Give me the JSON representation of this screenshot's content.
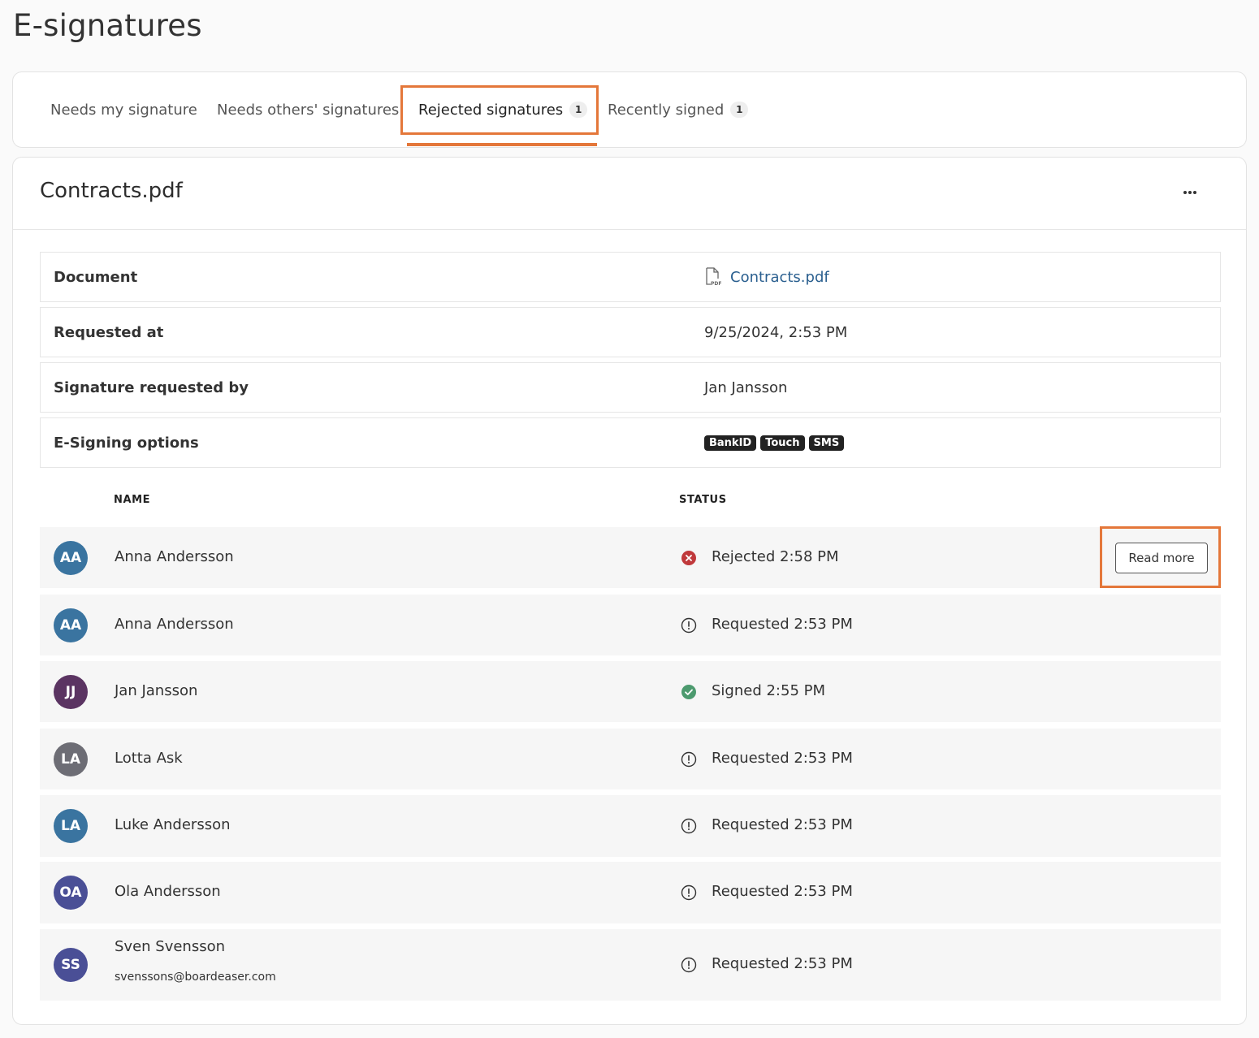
{
  "page": {
    "title": "E-signatures"
  },
  "tabs": [
    {
      "label": "Needs my signature",
      "count": ""
    },
    {
      "label": "Needs others' signatures",
      "count": ""
    },
    {
      "label": "Rejected signatures",
      "count": "1"
    },
    {
      "label": "Recently signed",
      "count": "1"
    }
  ],
  "document": {
    "title": "Contracts.pdf",
    "more_icon": "more-horizontal-icon",
    "info": {
      "document_label": "Document",
      "document_file": "Contracts.pdf",
      "requested_at_label": "Requested at",
      "requested_at": "9/25/2024, 2:53 PM",
      "requested_by_label": "Signature requested by",
      "requested_by": "Jan Jansson",
      "options_label": "E-Signing options",
      "options": [
        "BankID",
        "Touch",
        "SMS"
      ]
    }
  },
  "table": {
    "headers": {
      "name": "NAME",
      "status": "STATUS"
    },
    "read_more_label": "Read more",
    "rows": [
      {
        "initials": "AA",
        "name": "Anna Andersson",
        "email": "",
        "status": "Rejected 2:58 PM",
        "status_type": "rejected",
        "avatar_color": "#3a74a0"
      },
      {
        "initials": "AA",
        "name": "Anna Andersson",
        "email": "",
        "status": "Requested 2:53 PM",
        "status_type": "requested",
        "avatar_color": "#3a74a0"
      },
      {
        "initials": "JJ",
        "name": "Jan Jansson",
        "email": "",
        "status": "Signed 2:55 PM",
        "status_type": "signed",
        "avatar_color": "#5b3462"
      },
      {
        "initials": "LA",
        "name": "Lotta Ask",
        "email": "",
        "status": "Requested 2:53 PM",
        "status_type": "requested",
        "avatar_color": "#6d6d75"
      },
      {
        "initials": "LA",
        "name": "Luke Andersson",
        "email": "",
        "status": "Requested 2:53 PM",
        "status_type": "requested",
        "avatar_color": "#3a74a0"
      },
      {
        "initials": "OA",
        "name": "Ola Andersson",
        "email": "",
        "status": "Requested 2:53 PM",
        "status_type": "requested",
        "avatar_color": "#4a4f96"
      },
      {
        "initials": "SS",
        "name": "Sven Svensson",
        "email": "svenssons@boardeaser.com",
        "status": "Requested 2:53 PM",
        "status_type": "requested",
        "avatar_color": "#4a4f96"
      }
    ]
  },
  "colors": {
    "accent": "#e4773a",
    "rejected": "#c0393b",
    "signed": "#4c9a6e",
    "link": "#2a5f8f"
  }
}
